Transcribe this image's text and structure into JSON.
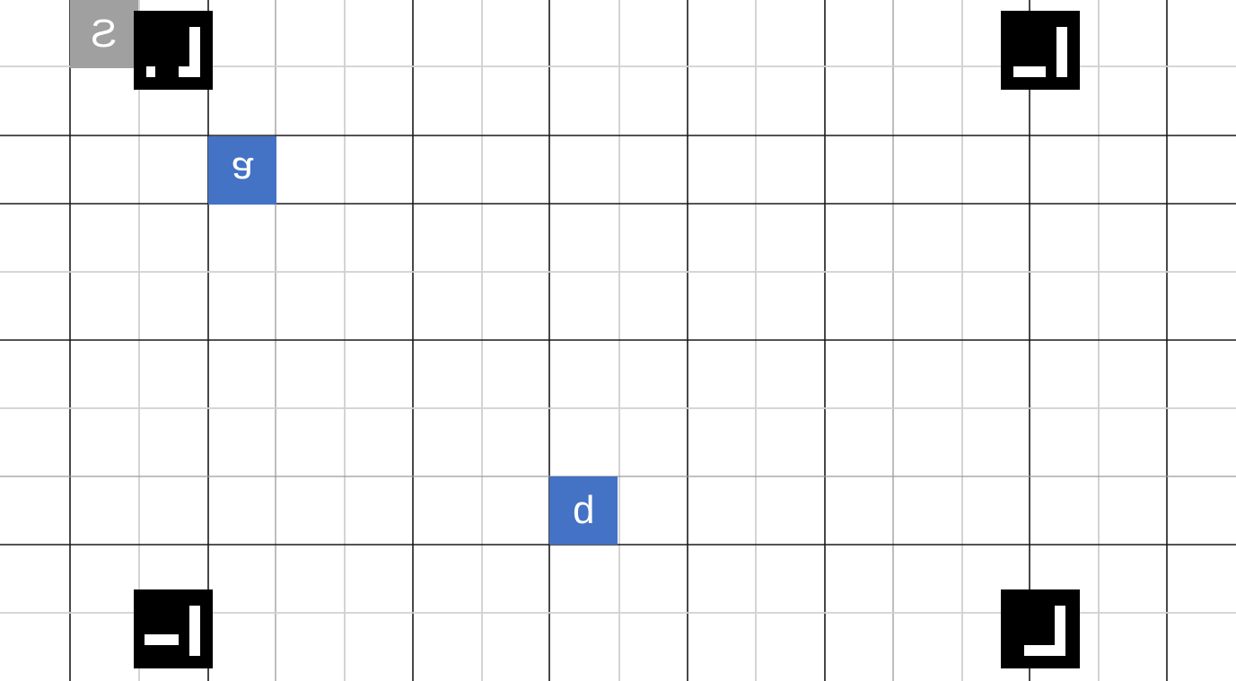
{
  "board": {
    "background": "#ffffff",
    "major_line_color": "#1a1a1a",
    "minor_line_color": "#d0d0d0",
    "mid_line_color": "#9a9a9a"
  },
  "tiles": [
    {
      "id": "tile-s",
      "label": "S",
      "color": "#a0a0a0",
      "orientation": "mirrored"
    },
    {
      "id": "tile-a",
      "label": "a",
      "color": "#4472c4",
      "orientation": "upside-down"
    },
    {
      "id": "tile-b",
      "label": "b",
      "color": "#4472c4",
      "orientation": "mirrored"
    }
  ],
  "markers": [
    {
      "id": "marker-top-left",
      "icon": "fiducial-marker-icon",
      "color": "#000000"
    },
    {
      "id": "marker-top-right",
      "icon": "fiducial-marker-icon",
      "color": "#000000"
    },
    {
      "id": "marker-bottom-left",
      "icon": "fiducial-marker-icon",
      "color": "#000000"
    },
    {
      "id": "marker-bottom-right",
      "icon": "fiducial-marker-icon",
      "color": "#000000"
    }
  ]
}
